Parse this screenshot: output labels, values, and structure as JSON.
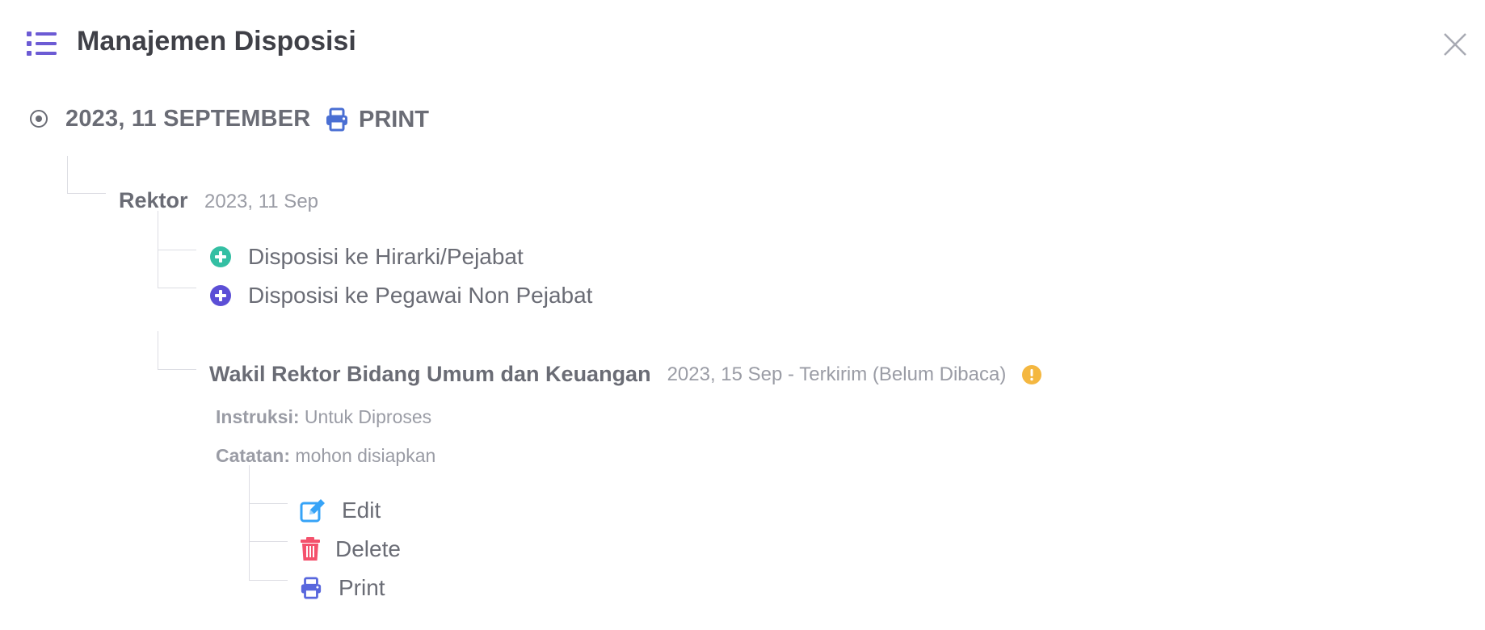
{
  "header": {
    "title": "Manajemen Disposisi",
    "menu_icon": "list-icon",
    "close_icon": "close-icon"
  },
  "date_row": {
    "date": "2023, 11 SEPTEMBER",
    "print_label": "PRINT"
  },
  "root": {
    "name": "Rektor",
    "date": "2023, 11 Sep",
    "actions": [
      {
        "label": "Disposisi ke Hirarki/Pejabat",
        "icon": "plus-circle-icon",
        "color": "#34bfa3"
      },
      {
        "label": "Disposisi ke Pegawai Non Pejabat",
        "icon": "plus-circle-icon",
        "color": "#5c4fd6"
      }
    ]
  },
  "child": {
    "name": "Wakil Rektor Bidang Umum dan Keuangan",
    "meta": "2023, 15 Sep - Terkirim (Belum Dibaca)",
    "status_icon": "exclamation-circle-icon",
    "status_color": "#f4b740",
    "instruksi_label": "Instruksi:",
    "instruksi_value": "Untuk Diproses",
    "catatan_label": "Catatan:",
    "catatan_value": "mohon disiapkan",
    "actions": [
      {
        "label": "Edit",
        "icon": "edit-icon",
        "color": "#36a3f7"
      },
      {
        "label": "Delete",
        "icon": "trash-icon",
        "color": "#f4516c"
      },
      {
        "label": "Print",
        "icon": "print-icon",
        "color": "#5867dd"
      }
    ]
  },
  "colors": {
    "accent": "#716aca",
    "print_blue": "#4a6fd3",
    "line": "#dcdde3"
  }
}
